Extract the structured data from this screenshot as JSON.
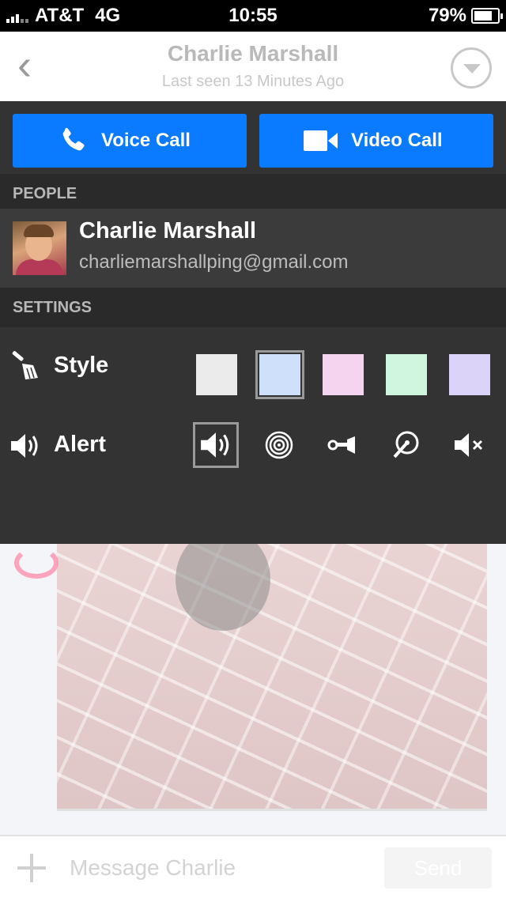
{
  "status_bar": {
    "carrier": "AT&T",
    "network": "4G",
    "time": "10:55",
    "battery": "79%",
    "battery_level": 0.79
  },
  "header": {
    "title": "Charlie Marshall",
    "subtitle": "Last seen 13 Minutes Ago",
    "back_icon": "chevron-left-icon",
    "menu_icon": "chevron-down-circle-icon"
  },
  "calls": {
    "voice_label": "Voice Call",
    "video_label": "Video Call",
    "color": "#0a7aff"
  },
  "people": {
    "section_label": "PEOPLE",
    "name": "Charlie Marshall",
    "email": "charliemarshallping@gmail.com"
  },
  "settings": {
    "section_label": "SETTINGS",
    "style_label": "Style",
    "style_colors": [
      "#ebebeb",
      "#cfe0fb",
      "#f4d4ee",
      "#d0f6e0",
      "#dcd4f8"
    ],
    "style_selected": 1,
    "alert_label": "Alert",
    "alert_options": [
      "speaker-icon",
      "target-icon",
      "horn-icon",
      "wand-icon",
      "mute-icon"
    ],
    "alert_selected": 0
  },
  "composer": {
    "placeholder": "Message Charlie",
    "send_label": "Send"
  }
}
